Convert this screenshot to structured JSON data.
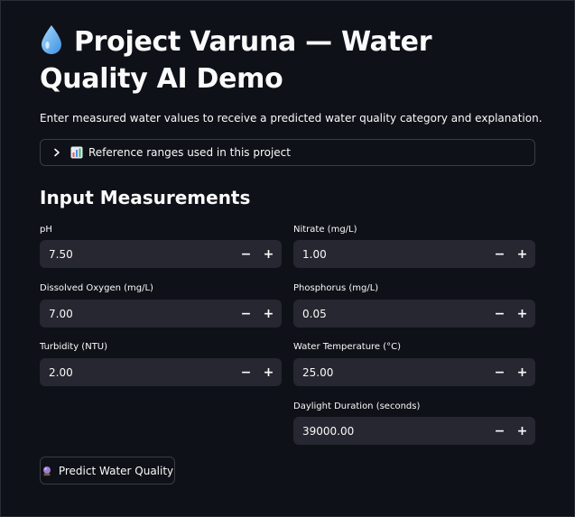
{
  "header": {
    "title": "Project Varuna — Water Quality AI Demo",
    "title_icon": "droplet-icon",
    "subtitle": "Enter measured water values to receive a predicted water quality category and explanation."
  },
  "expander": {
    "label": "Reference ranges used in this project",
    "icon": "bar-chart-icon",
    "expanded": false
  },
  "section": {
    "title": "Input Measurements"
  },
  "fields": [
    {
      "label": "pH",
      "value": "7.50"
    },
    {
      "label": "Nitrate (mg/L)",
      "value": "1.00"
    },
    {
      "label": "Dissolved Oxygen (mg/L)",
      "value": "7.00"
    },
    {
      "label": "Phosphorus (mg/L)",
      "value": "0.05"
    },
    {
      "label": "Turbidity (NTU)",
      "value": "2.00"
    },
    {
      "label": "Water Temperature (°C)",
      "value": "25.00"
    },
    {
      "label": "Daylight Duration (seconds)",
      "value": "39000.00"
    }
  ],
  "stepper": {
    "minus": "−",
    "plus": "+"
  },
  "predict_button": {
    "label": "Predict Water Quality",
    "icon": "crystal-ball-icon"
  },
  "colors": {
    "background": "#0e1117",
    "input_bg": "#262730",
    "border": "#3a3d45",
    "text": "#fafafa"
  }
}
